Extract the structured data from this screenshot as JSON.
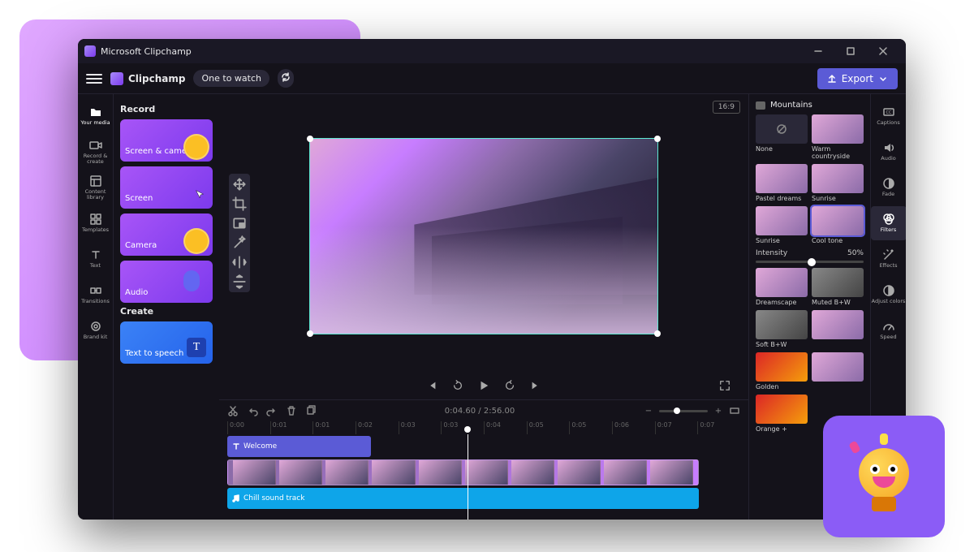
{
  "titlebar": {
    "title": "Microsoft Clipchamp"
  },
  "topbar": {
    "brand": "Clipchamp",
    "project_name": "One to watch",
    "export_label": "Export"
  },
  "rail_left": [
    {
      "id": "your-media",
      "label": "Your media"
    },
    {
      "id": "record-create",
      "label": "Record & create"
    },
    {
      "id": "content-library",
      "label": "Content library"
    },
    {
      "id": "templates",
      "label": "Templates"
    },
    {
      "id": "text",
      "label": "Text"
    },
    {
      "id": "transitions",
      "label": "Transitions"
    },
    {
      "id": "brand-kit",
      "label": "Brand kit"
    }
  ],
  "panel_left": {
    "section1_title": "Record",
    "cards1": [
      {
        "id": "screen-camera",
        "label": "Screen & camera"
      },
      {
        "id": "screen",
        "label": "Screen"
      },
      {
        "id": "camera",
        "label": "Camera"
      },
      {
        "id": "audio",
        "label": "Audio"
      }
    ],
    "section2_title": "Create",
    "cards2": [
      {
        "id": "tts",
        "label": "Text to speech"
      }
    ]
  },
  "preview": {
    "aspect": "16:9",
    "tools": [
      "move",
      "crop",
      "picture",
      "magic",
      "fliph",
      "flipv"
    ]
  },
  "playback": {
    "current_time": "0:04.60",
    "total_time": "2:56.00"
  },
  "timeline": {
    "ticks": [
      "0:00",
      "0:01",
      "0:01",
      "0:02",
      "0:03",
      "0:03",
      "0:04",
      "0:05",
      "0:05",
      "0:06",
      "0:07",
      "0:07"
    ],
    "text_track_label": "Welcome",
    "audio_track_label": "Chill sound track"
  },
  "panel_right": {
    "clip_name": "Mountains",
    "filters": [
      {
        "id": "none",
        "label": "None"
      },
      {
        "id": "warm",
        "label": "Warm countryside"
      },
      {
        "id": "pastel",
        "label": "Pastel dreams"
      },
      {
        "id": "sunrise",
        "label": "Sunrise"
      },
      {
        "id": "sunrise2",
        "label": "Sunrise"
      },
      {
        "id": "cool",
        "label": "Cool tone"
      }
    ],
    "filters_more": [
      {
        "id": "dreamscape",
        "label": "Dreamscape"
      },
      {
        "id": "mutedbw",
        "label": "Muted B+W"
      },
      {
        "id": "softbw",
        "label": "Soft B+W"
      },
      {
        "id": "blank1",
        "label": ""
      },
      {
        "id": "golden",
        "label": "Golden"
      },
      {
        "id": "blank2",
        "label": ""
      },
      {
        "id": "orange",
        "label": "Orange +"
      }
    ],
    "intensity_label": "Intensity",
    "intensity_value": "50%"
  },
  "rail_right": [
    {
      "id": "captions",
      "label": "Captions"
    },
    {
      "id": "audio",
      "label": "Audio"
    },
    {
      "id": "fade",
      "label": "Fade"
    },
    {
      "id": "filters",
      "label": "Filters"
    },
    {
      "id": "effects",
      "label": "Effects"
    },
    {
      "id": "adjust",
      "label": "Adjust colors"
    },
    {
      "id": "speed",
      "label": "Speed"
    }
  ]
}
